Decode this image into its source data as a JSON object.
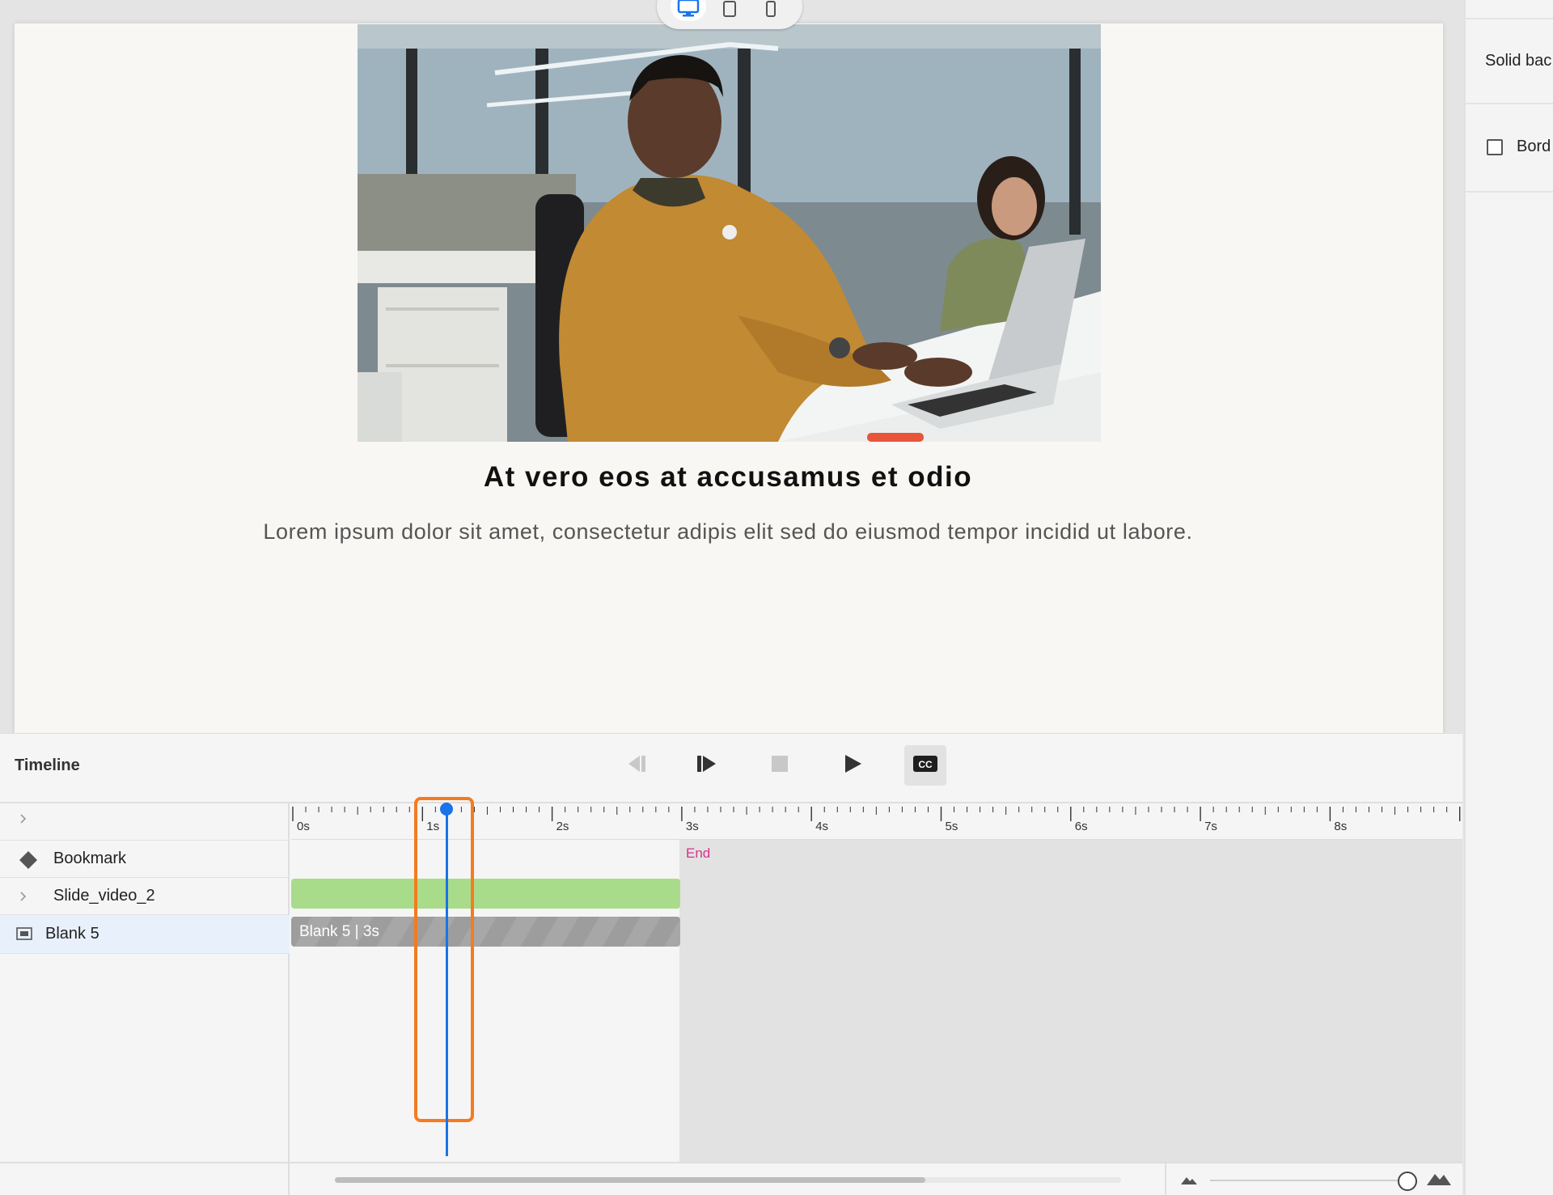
{
  "device_preview": {
    "desktop_icon": "desktop-icon",
    "tablet_icon": "tablet-icon",
    "mobile_icon": "mobile-icon"
  },
  "slide": {
    "title": "At vero eos at accusamus et odio",
    "body": "Lorem ipsum dolor sit amet, consectetur adipis elit sed do eiusmod tempor incidid ut labore."
  },
  "properties": {
    "background_label": "Solid bac",
    "border_label": "Bord"
  },
  "timeline": {
    "title": "Timeline",
    "controls": [
      "previous-icon",
      "next-icon",
      "stop-icon",
      "play-icon",
      "cc-icon"
    ],
    "cc_label": "CC",
    "expand_icon": "chevron-right-icon",
    "layers": [
      {
        "label": "Bookmark",
        "icon": "bookmark-diamond-icon"
      },
      {
        "label": "Slide_video_2",
        "icon": "chevron-right-icon"
      },
      {
        "label": "Blank 5",
        "icon": "slide-icon"
      }
    ],
    "ruler_labels": [
      "0s",
      "1s",
      "2s",
      "3s",
      "4s",
      "5s",
      "6s",
      "7s",
      "8s"
    ],
    "end_label": "End",
    "blank_bar_label": "Blank 5 | 3s",
    "playhead_seconds": 1.2,
    "slide_duration_seconds": 3
  },
  "colors": {
    "accent": "#1a73e8",
    "highlight": "#f47b20",
    "video_track": "#a9dc8a",
    "end_marker": "#d6338a"
  }
}
